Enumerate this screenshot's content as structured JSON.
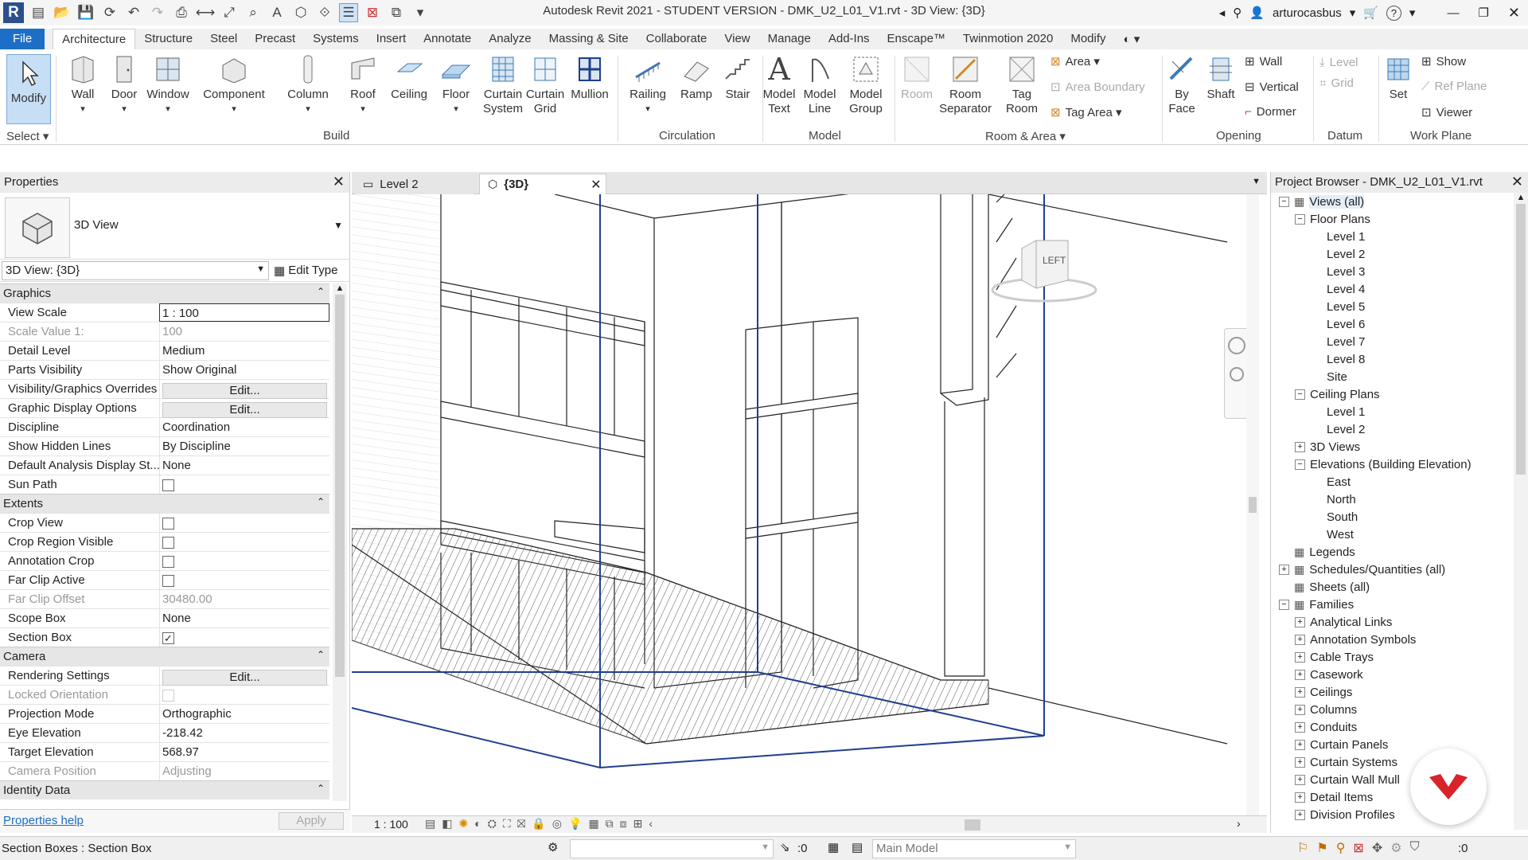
{
  "window": {
    "title": "Autodesk Revit 2021 - STUDENT VERSION - DMK_U2_L01_V1.rvt - 3D View: {3D}",
    "user": "arturocasbus"
  },
  "tabs": [
    "File",
    "Architecture",
    "Structure",
    "Steel",
    "Precast",
    "Systems",
    "Insert",
    "Annotate",
    "Analyze",
    "Massing & Site",
    "Collaborate",
    "View",
    "Manage",
    "Add-Ins",
    "Enscape™",
    "Twinmotion 2020",
    "Modify"
  ],
  "active_tab": "Architecture",
  "ribbon": {
    "select": {
      "modify": "Modify",
      "label": "Select ▾"
    },
    "build": {
      "label": "Build",
      "wall": "Wall",
      "door": "Door",
      "window": "Window",
      "component": "Component",
      "column": "Column",
      "roof": "Roof",
      "ceiling": "Ceiling",
      "floor": "Floor",
      "curtain_system": "Curtain System",
      "curtain_grid": "Curtain Grid",
      "mullion": "Mullion"
    },
    "circulation": {
      "label": "Circulation",
      "railing": "Railing",
      "ramp": "Ramp",
      "stair": "Stair"
    },
    "model": {
      "label": "Model",
      "model_text": "Model Text",
      "model_line": "Model Line",
      "model_group": "Model Group"
    },
    "room_area": {
      "label": "Room & Area ▾",
      "room": "Room",
      "room_separator": "Room Separator",
      "tag_room": "Tag Room",
      "area": "Area ▾",
      "area_boundary": "Area  Boundary",
      "tag_area": "Tag  Area ▾"
    },
    "opening": {
      "label": "Opening",
      "by_face": "By Face",
      "shaft": "Shaft",
      "wall": "Wall",
      "vertical": "Vertical",
      "dormer": "Dormer"
    },
    "datum": {
      "label": "Datum",
      "level": "Level",
      "grid": "Grid"
    },
    "work_plane": {
      "label": "Work Plane",
      "set": "Set",
      "show": "Show",
      "ref_plane": "Ref  Plane",
      "viewer": "Viewer"
    }
  },
  "properties": {
    "title": "Properties",
    "type_name": "3D View",
    "selector": "3D View: {3D}",
    "edit_type": "Edit Type",
    "groups": [
      {
        "name": "Graphics",
        "rows": [
          {
            "k": "View Scale",
            "v": "1 : 100",
            "kind": "input"
          },
          {
            "k": "Scale Value    1:",
            "v": "100",
            "kind": "dim"
          },
          {
            "k": "Detail Level",
            "v": "Medium"
          },
          {
            "k": "Parts Visibility",
            "v": "Show Original"
          },
          {
            "k": "Visibility/Graphics Overrides",
            "v": "Edit...",
            "kind": "button"
          },
          {
            "k": "Graphic Display Options",
            "v": "Edit...",
            "kind": "button"
          },
          {
            "k": "Discipline",
            "v": "Coordination"
          },
          {
            "k": "Show Hidden Lines",
            "v": "By Discipline"
          },
          {
            "k": "Default Analysis Display St...",
            "v": "None"
          },
          {
            "k": "Sun Path",
            "v": "",
            "kind": "check",
            "checked": false
          }
        ]
      },
      {
        "name": "Extents",
        "rows": [
          {
            "k": "Crop View",
            "v": "",
            "kind": "check",
            "checked": false
          },
          {
            "k": "Crop Region Visible",
            "v": "",
            "kind": "check",
            "checked": false
          },
          {
            "k": "Annotation Crop",
            "v": "",
            "kind": "check",
            "checked": false
          },
          {
            "k": "Far Clip Active",
            "v": "",
            "kind": "check",
            "checked": false
          },
          {
            "k": "Far Clip Offset",
            "v": "30480.00",
            "kind": "dim"
          },
          {
            "k": "Scope Box",
            "v": "None"
          },
          {
            "k": "Section Box",
            "v": "",
            "kind": "check",
            "checked": true
          }
        ]
      },
      {
        "name": "Camera",
        "rows": [
          {
            "k": "Rendering Settings",
            "v": "Edit...",
            "kind": "button"
          },
          {
            "k": "Locked Orientation",
            "v": "",
            "kind": "checkdim",
            "checked": false
          },
          {
            "k": "Projection Mode",
            "v": "Orthographic"
          },
          {
            "k": "Eye Elevation",
            "v": "-218.42"
          },
          {
            "k": "Target Elevation",
            "v": "568.97"
          },
          {
            "k": "Camera Position",
            "v": "Adjusting",
            "kind": "dim"
          }
        ]
      },
      {
        "name": "Identity Data",
        "rows": []
      }
    ],
    "help": "Properties help",
    "apply": "Apply"
  },
  "view_tabs": [
    {
      "label": "Level 2"
    },
    {
      "label": "{3D}"
    }
  ],
  "viewcube": {
    "face": "LEFT"
  },
  "view_bar": {
    "scale": "1 : 100"
  },
  "project_browser": {
    "title": "Project Browser - DMK_U2_L01_V1.rvt",
    "tree": [
      {
        "t": "Views (all)",
        "lvl": 0,
        "tw": "−",
        "icon": true
      },
      {
        "t": "Floor Plans",
        "lvl": 1,
        "tw": "−"
      },
      {
        "t": "Level 1",
        "lvl": 2
      },
      {
        "t": "Level 2",
        "lvl": 2
      },
      {
        "t": "Level 3",
        "lvl": 2
      },
      {
        "t": "Level 4",
        "lvl": 2
      },
      {
        "t": "Level 5",
        "lvl": 2
      },
      {
        "t": "Level 6",
        "lvl": 2
      },
      {
        "t": "Level 7",
        "lvl": 2
      },
      {
        "t": "Level 8",
        "lvl": 2
      },
      {
        "t": "Site",
        "lvl": 2
      },
      {
        "t": "Ceiling Plans",
        "lvl": 1,
        "tw": "−"
      },
      {
        "t": "Level 1",
        "lvl": 2
      },
      {
        "t": "Level 2",
        "lvl": 2
      },
      {
        "t": "3D Views",
        "lvl": 1,
        "tw": "+"
      },
      {
        "t": "Elevations (Building Elevation)",
        "lvl": 1,
        "tw": "−"
      },
      {
        "t": "East",
        "lvl": 2
      },
      {
        "t": "North",
        "lvl": 2
      },
      {
        "t": "South",
        "lvl": 2
      },
      {
        "t": "West",
        "lvl": 2
      },
      {
        "t": "Legends",
        "lvl": 0,
        "icon": true
      },
      {
        "t": "Schedules/Quantities (all)",
        "lvl": 0,
        "tw": "+",
        "icon": true
      },
      {
        "t": "Sheets (all)",
        "lvl": 0,
        "icon": true
      },
      {
        "t": "Families",
        "lvl": 0,
        "tw": "−",
        "icon": true
      },
      {
        "t": "Analytical Links",
        "lvl": 1,
        "tw": "+"
      },
      {
        "t": "Annotation Symbols",
        "lvl": 1,
        "tw": "+"
      },
      {
        "t": "Cable Trays",
        "lvl": 1,
        "tw": "+"
      },
      {
        "t": "Casework",
        "lvl": 1,
        "tw": "+"
      },
      {
        "t": "Ceilings",
        "lvl": 1,
        "tw": "+"
      },
      {
        "t": "Columns",
        "lvl": 1,
        "tw": "+"
      },
      {
        "t": "Conduits",
        "lvl": 1,
        "tw": "+"
      },
      {
        "t": "Curtain Panels",
        "lvl": 1,
        "tw": "+"
      },
      {
        "t": "Curtain Systems",
        "lvl": 1,
        "tw": "+"
      },
      {
        "t": "Curtain Wall Mull",
        "lvl": 1,
        "tw": "+"
      },
      {
        "t": "Detail Items",
        "lvl": 1,
        "tw": "+"
      },
      {
        "t": "Division Profiles",
        "lvl": 1,
        "tw": "+"
      }
    ]
  },
  "status": {
    "text": "Section Boxes : Section Box",
    "sel_count": ":0",
    "workset": "Main Model",
    "filter_count": ":0"
  },
  "colors": {
    "accent": "#1d6ec6",
    "section_box": "#1f3f8f",
    "logo": "#2b4f8c",
    "badge": "#d8232a"
  }
}
